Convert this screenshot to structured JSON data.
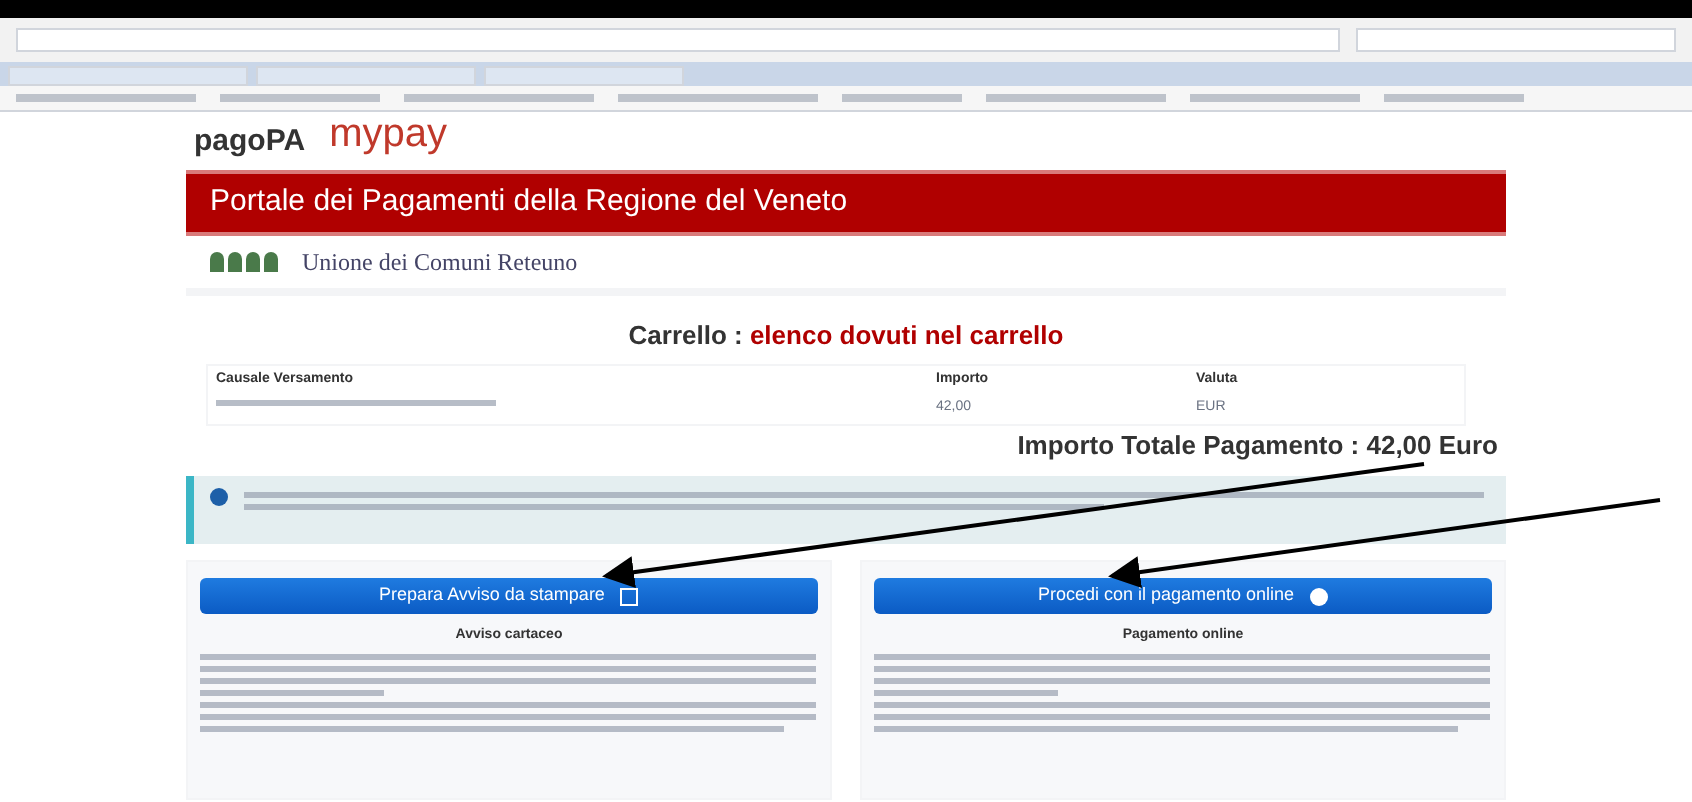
{
  "header": {
    "logo_left": "pagoPA",
    "logo_right": "mypay",
    "banner": "Portale dei Pagamenti della Regione del Veneto",
    "entity": "Unione dei Comuni Reteuno"
  },
  "cart": {
    "title_prefix": "Carrello : ",
    "title_rest": "elenco dovuti nel carrello",
    "columns": [
      "Causale Versamento",
      "Importo",
      "Valuta"
    ],
    "rows": [
      {
        "cells": [
          "",
          "42,00",
          "EUR"
        ]
      }
    ],
    "total": "Importo Totale Pagamento : 42,00 Euro"
  },
  "options": [
    {
      "button": "Prepara Avviso da stampare",
      "kind": "paper",
      "heading": "Avviso cartaceo"
    },
    {
      "button": "Procedi con il pagamento online",
      "kind": "online",
      "heading": "Pagamento online"
    }
  ]
}
